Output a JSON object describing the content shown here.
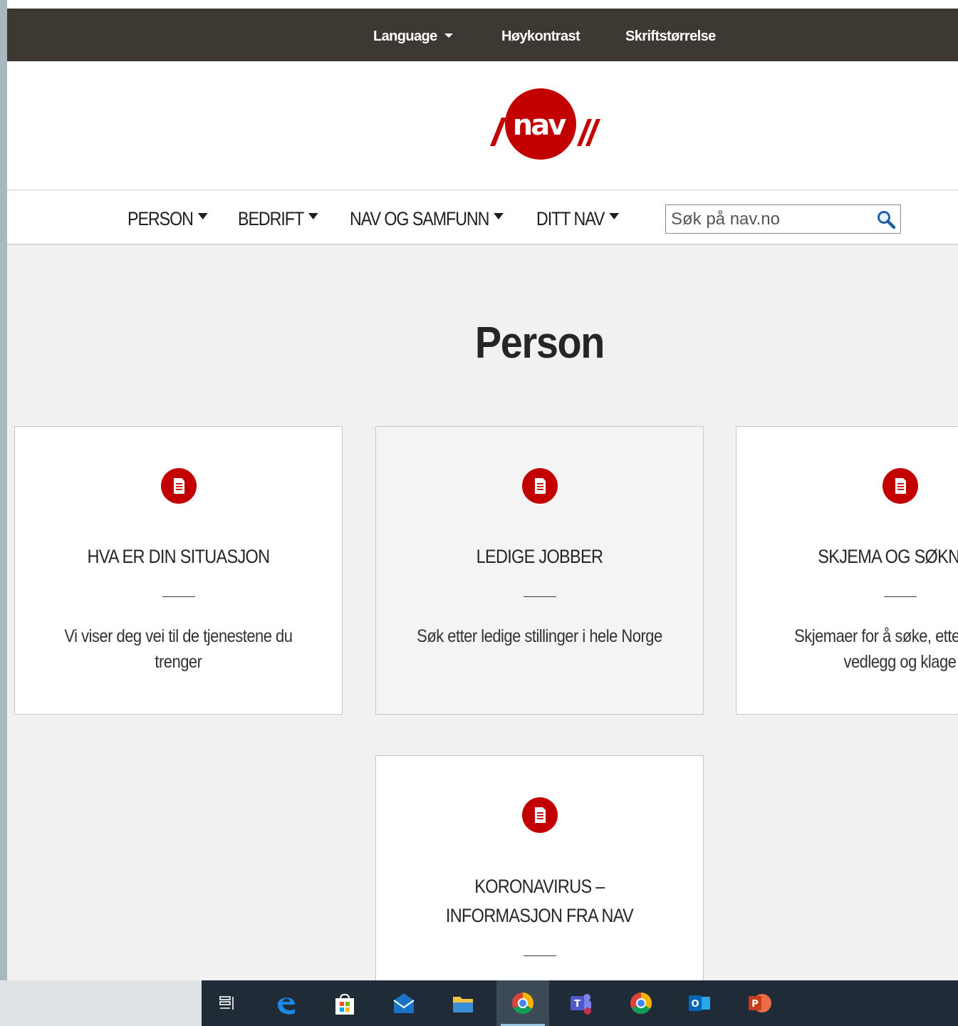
{
  "utility_bar": {
    "language": "Language",
    "high_contrast": "Høykontrast",
    "font_size": "Skriftstørrelse"
  },
  "logo": {
    "text": "nav",
    "color": "#c30000"
  },
  "nav": {
    "items": [
      "PERSON",
      "BEDRIFT",
      "NAV OG SAMFUNN",
      "DITT NAV"
    ],
    "search_placeholder": "Søk på nav.no"
  },
  "page_title": "Person",
  "cards": [
    {
      "title": "HVA ER DIN SITUASJON",
      "description": "Vi viser deg vei til de tjenestene du trenger",
      "icon": "document-icon"
    },
    {
      "title": "LEDIGE JOBBER",
      "description": "Søk etter ledige stillinger i hele Norge",
      "icon": "document-icon"
    },
    {
      "title": "SKJEMA OG SØKNAD",
      "description": "Skjemaer for å søke, ettersende vedlegg og klage",
      "icon": "document-icon"
    },
    {
      "title": "KORONAVIRUS – INFORMASJON FRA NAV",
      "description": "",
      "icon": "document-icon"
    }
  ],
  "taskbar": {
    "apps": [
      "task-view",
      "edge",
      "store",
      "mail",
      "file-explorer",
      "chrome",
      "teams",
      "chrome",
      "outlook",
      "powerpoint"
    ]
  },
  "colors": {
    "nav_red": "#c30000",
    "utility_bar": "#3e3832",
    "page_background": "#f1f1f1",
    "taskbar": "#1f2b36"
  }
}
